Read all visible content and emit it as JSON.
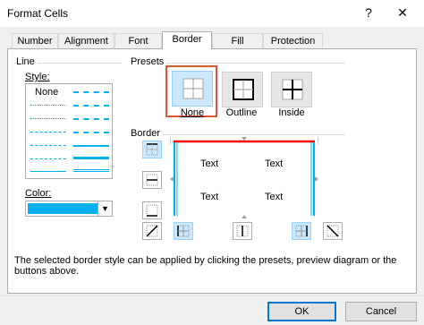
{
  "window": {
    "title": "Format Cells",
    "help": "?",
    "close": "✕"
  },
  "tabs": [
    {
      "label": "Number"
    },
    {
      "label": "Alignment"
    },
    {
      "label": "Font"
    },
    {
      "label": "Border",
      "active": true
    },
    {
      "label": "Fill"
    },
    {
      "label": "Protection"
    }
  ],
  "line": {
    "group_label": "Line",
    "style_label": "Style:",
    "style_none": "None",
    "color_label": "Color:",
    "color_value": "#00b0f0"
  },
  "presets": {
    "group_label": "Presets",
    "items": [
      {
        "label": "None",
        "selected": true
      },
      {
        "label": "Outline"
      },
      {
        "label": "Inside"
      }
    ]
  },
  "border": {
    "group_label": "Border",
    "preview_text": [
      "Text",
      "Text",
      "Text",
      "Text"
    ],
    "accent_color": "#ff0000",
    "line_color": "#00b0f0"
  },
  "hint": "The selected border style can be applied by clicking the presets, preview diagram or the buttons above.",
  "buttons": {
    "ok": "OK",
    "cancel": "Cancel"
  },
  "colors": {
    "selection": "#cce8ff",
    "highlight": "#e1552f"
  }
}
